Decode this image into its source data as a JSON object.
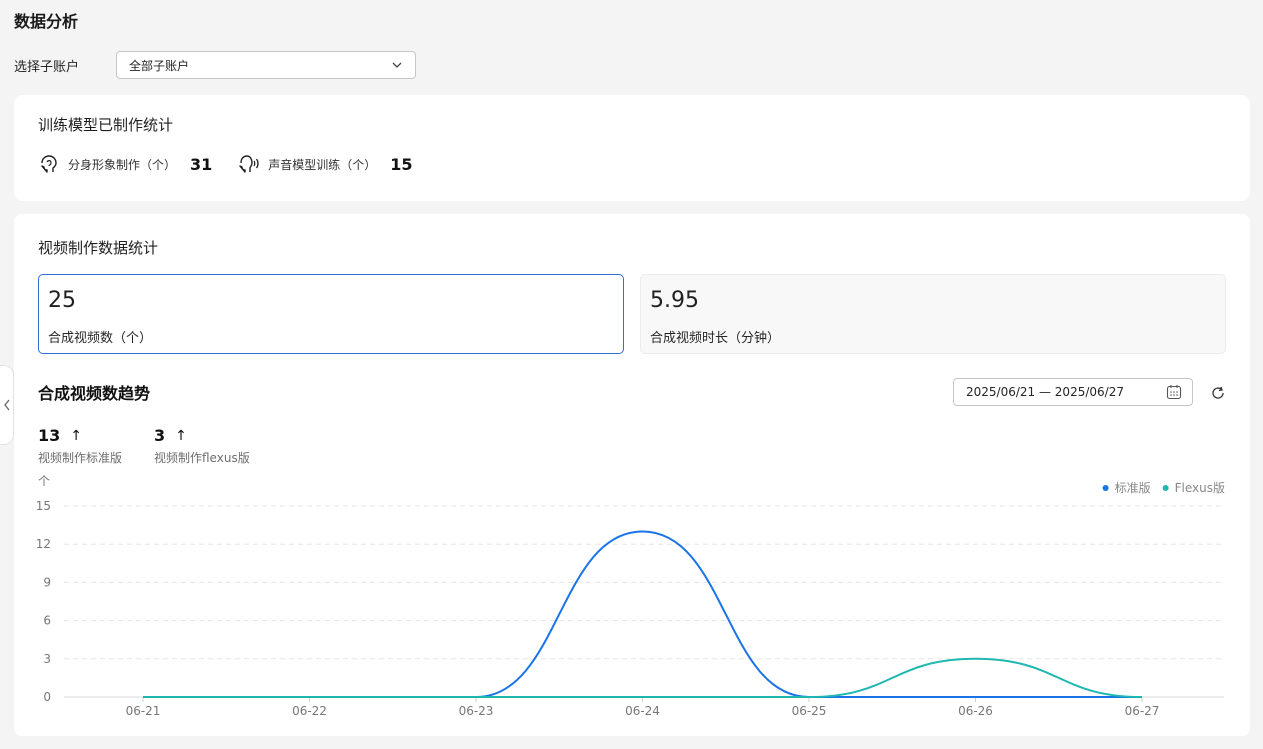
{
  "header": {
    "title": "数据分析"
  },
  "account_filter": {
    "label": "选择子账户",
    "selected": "全部子账户"
  },
  "training": {
    "title": "训练模型已制作统计",
    "stats": [
      {
        "label": "分身形象制作（个）",
        "value": "31",
        "icon": "avatar-head-icon"
      },
      {
        "label": "声音模型训练（个）",
        "value": "15",
        "icon": "voice-head-icon"
      }
    ]
  },
  "video": {
    "title": "视频制作数据统计",
    "metrics": [
      {
        "value": "25",
        "label": "合成视频数（个）",
        "active": true
      },
      {
        "value": "5.95",
        "label": "合成视频时长（分钟）",
        "active": false
      }
    ],
    "trend_title": "合成视频数趋势",
    "date_range": "2025/06/21 — 2025/06/27",
    "summary": [
      {
        "value": "13",
        "label": "视频制作标准版",
        "trend": "↑"
      },
      {
        "value": "3",
        "label": "视频制作flexus版",
        "trend": "↑"
      }
    ]
  },
  "chart_data": {
    "type": "line",
    "ylabel": "个",
    "ylim": [
      0,
      15
    ],
    "yticks": [
      0,
      3,
      6,
      9,
      12,
      15
    ],
    "x": [
      "06-21",
      "06-22",
      "06-23",
      "06-24",
      "06-25",
      "06-26",
      "06-27"
    ],
    "series": [
      {
        "name": "标准版",
        "values": [
          0,
          0,
          0,
          13,
          0,
          0,
          0
        ],
        "color": "#1a73e8"
      },
      {
        "name": "Flexus版",
        "values": [
          0,
          0,
          0,
          0,
          0,
          3,
          0
        ],
        "color": "#1fb8b0"
      }
    ],
    "legend_position": "top-right",
    "grid": true
  },
  "icons": {
    "calendar": "calendar-icon",
    "refresh": "refresh-icon",
    "dropdown": "chevron-down-icon",
    "collapse": "chevron-left-icon"
  }
}
